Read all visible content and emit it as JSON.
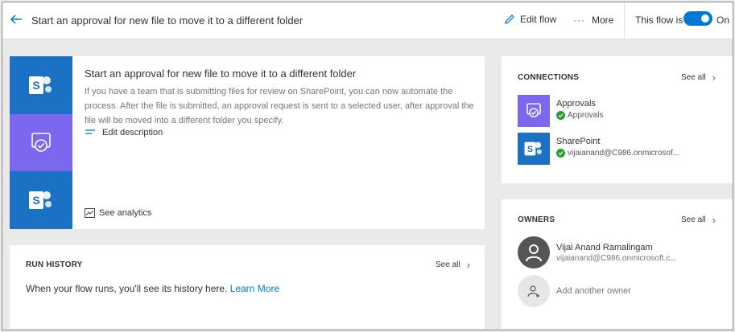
{
  "header": {
    "title": "Start an approval for new file to move it to a different folder",
    "edit_flow": "Edit flow",
    "more_dots": "···",
    "more": "More",
    "flow_is": "This flow is",
    "toggle_state": "On"
  },
  "description": {
    "title": "Start an approval for new file to move it to a different folder",
    "text": "If you have a team that is submitting files for review on SharePoint, you can now automate the process. After the file is submitted, an approval request is sent to a selected user, after approval the file will be moved into a different folder you specify.",
    "edit_description": "Edit description",
    "see_analytics": "See analytics"
  },
  "run_history": {
    "title": "RUN HISTORY",
    "see_all": "See all",
    "empty_text": "When your flow runs, you'll see its history here.",
    "learn_more": "Learn More"
  },
  "connections": {
    "title": "CONNECTIONS",
    "see_all": "See all",
    "items": [
      {
        "name": "Approvals",
        "detail": "Approvals",
        "icon": "approvals-icon",
        "color": "#7b68ee"
      },
      {
        "name": "SharePoint",
        "detail": "vijaianand@C986.onmicrosof...",
        "icon": "sharepoint-icon",
        "color": "#1b72c5"
      }
    ]
  },
  "owners": {
    "title": "OWNERS",
    "see_all": "See all",
    "items": [
      {
        "name": "Vijai Anand Ramalingam",
        "email": "vijaianand@C986.onmicrosoft.c..."
      }
    ],
    "add_owner": "Add another owner"
  },
  "colors": {
    "accent": "#0078d4",
    "sharepoint": "#1b72c5",
    "approvals": "#7b68ee",
    "success": "#23a02d"
  }
}
